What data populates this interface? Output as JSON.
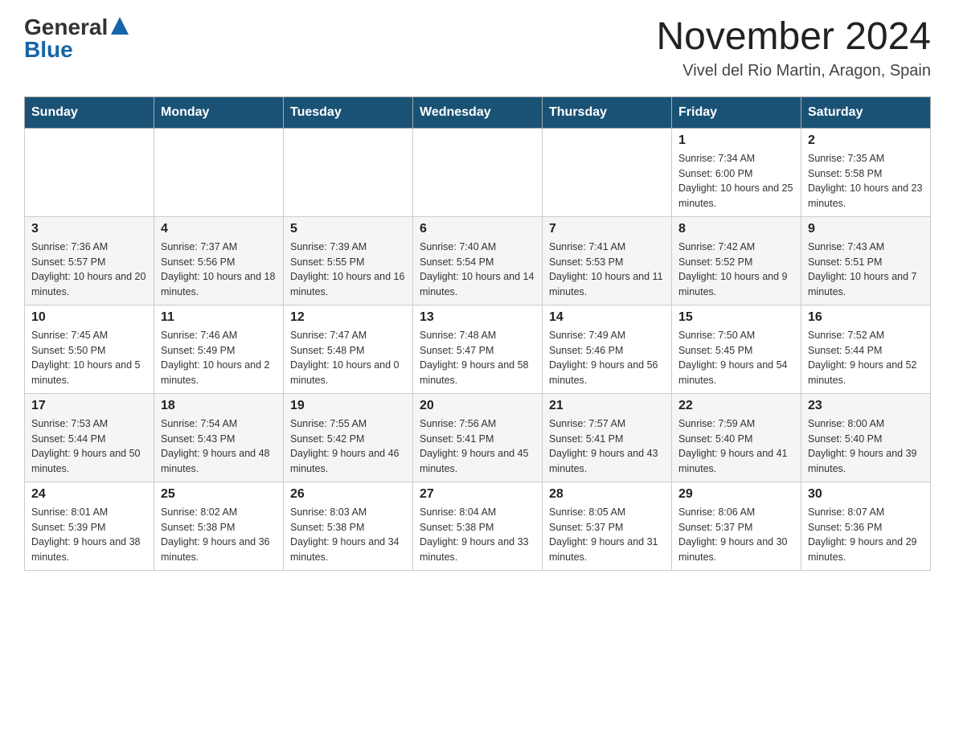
{
  "header": {
    "logo_general": "General",
    "logo_blue": "Blue",
    "month_year": "November 2024",
    "location": "Vivel del Rio Martin, Aragon, Spain"
  },
  "calendar": {
    "columns": [
      "Sunday",
      "Monday",
      "Tuesday",
      "Wednesday",
      "Thursday",
      "Friday",
      "Saturday"
    ],
    "rows": [
      [
        {
          "day": "",
          "info": ""
        },
        {
          "day": "",
          "info": ""
        },
        {
          "day": "",
          "info": ""
        },
        {
          "day": "",
          "info": ""
        },
        {
          "day": "",
          "info": ""
        },
        {
          "day": "1",
          "info": "Sunrise: 7:34 AM\nSunset: 6:00 PM\nDaylight: 10 hours and 25 minutes."
        },
        {
          "day": "2",
          "info": "Sunrise: 7:35 AM\nSunset: 5:58 PM\nDaylight: 10 hours and 23 minutes."
        }
      ],
      [
        {
          "day": "3",
          "info": "Sunrise: 7:36 AM\nSunset: 5:57 PM\nDaylight: 10 hours and 20 minutes."
        },
        {
          "day": "4",
          "info": "Sunrise: 7:37 AM\nSunset: 5:56 PM\nDaylight: 10 hours and 18 minutes."
        },
        {
          "day": "5",
          "info": "Sunrise: 7:39 AM\nSunset: 5:55 PM\nDaylight: 10 hours and 16 minutes."
        },
        {
          "day": "6",
          "info": "Sunrise: 7:40 AM\nSunset: 5:54 PM\nDaylight: 10 hours and 14 minutes."
        },
        {
          "day": "7",
          "info": "Sunrise: 7:41 AM\nSunset: 5:53 PM\nDaylight: 10 hours and 11 minutes."
        },
        {
          "day": "8",
          "info": "Sunrise: 7:42 AM\nSunset: 5:52 PM\nDaylight: 10 hours and 9 minutes."
        },
        {
          "day": "9",
          "info": "Sunrise: 7:43 AM\nSunset: 5:51 PM\nDaylight: 10 hours and 7 minutes."
        }
      ],
      [
        {
          "day": "10",
          "info": "Sunrise: 7:45 AM\nSunset: 5:50 PM\nDaylight: 10 hours and 5 minutes."
        },
        {
          "day": "11",
          "info": "Sunrise: 7:46 AM\nSunset: 5:49 PM\nDaylight: 10 hours and 2 minutes."
        },
        {
          "day": "12",
          "info": "Sunrise: 7:47 AM\nSunset: 5:48 PM\nDaylight: 10 hours and 0 minutes."
        },
        {
          "day": "13",
          "info": "Sunrise: 7:48 AM\nSunset: 5:47 PM\nDaylight: 9 hours and 58 minutes."
        },
        {
          "day": "14",
          "info": "Sunrise: 7:49 AM\nSunset: 5:46 PM\nDaylight: 9 hours and 56 minutes."
        },
        {
          "day": "15",
          "info": "Sunrise: 7:50 AM\nSunset: 5:45 PM\nDaylight: 9 hours and 54 minutes."
        },
        {
          "day": "16",
          "info": "Sunrise: 7:52 AM\nSunset: 5:44 PM\nDaylight: 9 hours and 52 minutes."
        }
      ],
      [
        {
          "day": "17",
          "info": "Sunrise: 7:53 AM\nSunset: 5:44 PM\nDaylight: 9 hours and 50 minutes."
        },
        {
          "day": "18",
          "info": "Sunrise: 7:54 AM\nSunset: 5:43 PM\nDaylight: 9 hours and 48 minutes."
        },
        {
          "day": "19",
          "info": "Sunrise: 7:55 AM\nSunset: 5:42 PM\nDaylight: 9 hours and 46 minutes."
        },
        {
          "day": "20",
          "info": "Sunrise: 7:56 AM\nSunset: 5:41 PM\nDaylight: 9 hours and 45 minutes."
        },
        {
          "day": "21",
          "info": "Sunrise: 7:57 AM\nSunset: 5:41 PM\nDaylight: 9 hours and 43 minutes."
        },
        {
          "day": "22",
          "info": "Sunrise: 7:59 AM\nSunset: 5:40 PM\nDaylight: 9 hours and 41 minutes."
        },
        {
          "day": "23",
          "info": "Sunrise: 8:00 AM\nSunset: 5:40 PM\nDaylight: 9 hours and 39 minutes."
        }
      ],
      [
        {
          "day": "24",
          "info": "Sunrise: 8:01 AM\nSunset: 5:39 PM\nDaylight: 9 hours and 38 minutes."
        },
        {
          "day": "25",
          "info": "Sunrise: 8:02 AM\nSunset: 5:38 PM\nDaylight: 9 hours and 36 minutes."
        },
        {
          "day": "26",
          "info": "Sunrise: 8:03 AM\nSunset: 5:38 PM\nDaylight: 9 hours and 34 minutes."
        },
        {
          "day": "27",
          "info": "Sunrise: 8:04 AM\nSunset: 5:38 PM\nDaylight: 9 hours and 33 minutes."
        },
        {
          "day": "28",
          "info": "Sunrise: 8:05 AM\nSunset: 5:37 PM\nDaylight: 9 hours and 31 minutes."
        },
        {
          "day": "29",
          "info": "Sunrise: 8:06 AM\nSunset: 5:37 PM\nDaylight: 9 hours and 30 minutes."
        },
        {
          "day": "30",
          "info": "Sunrise: 8:07 AM\nSunset: 5:36 PM\nDaylight: 9 hours and 29 minutes."
        }
      ]
    ]
  }
}
